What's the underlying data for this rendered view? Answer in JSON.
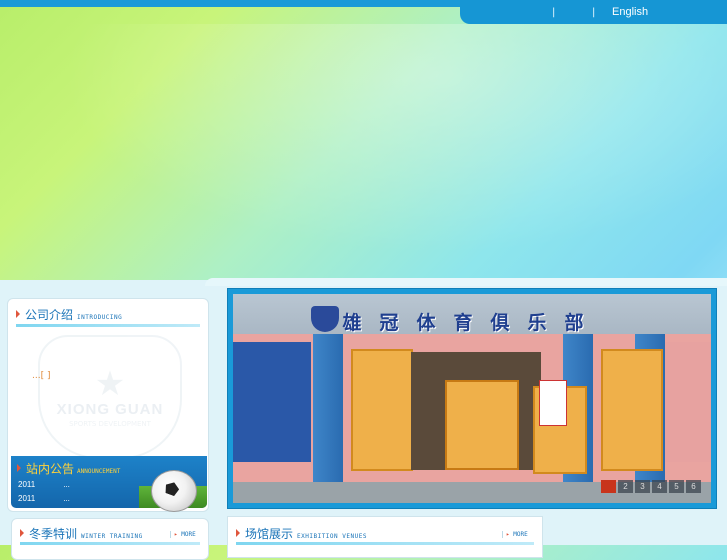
{
  "topnav": {
    "sep1": "|",
    "sep2": "|",
    "english": "English"
  },
  "intro": {
    "title_cn": "公司介绍",
    "title_en": "INTRODUCING",
    "more_text": "...[ ]",
    "logo_text": "XIONG GUAN",
    "logo_sub": "SPORTS DEVELOPMENT"
  },
  "announce": {
    "title_cn": "站内公告",
    "title_en": "ANNOUNCEMENT",
    "rows": [
      {
        "date": "2011",
        "text": "..."
      },
      {
        "date": "2011",
        "text": "..."
      }
    ]
  },
  "winter": {
    "title_cn": "冬季特训",
    "title_en": "WINTER TRAINING",
    "more": "MORE"
  },
  "venues": {
    "title_cn": "场馆展示",
    "title_en": "EXHIBITION VENUES",
    "more": "MORE"
  },
  "slider": {
    "sign_text": "雄冠体育俱乐部",
    "pages": [
      "1",
      "2",
      "3",
      "4",
      "5",
      "6"
    ],
    "active_page": "1"
  }
}
